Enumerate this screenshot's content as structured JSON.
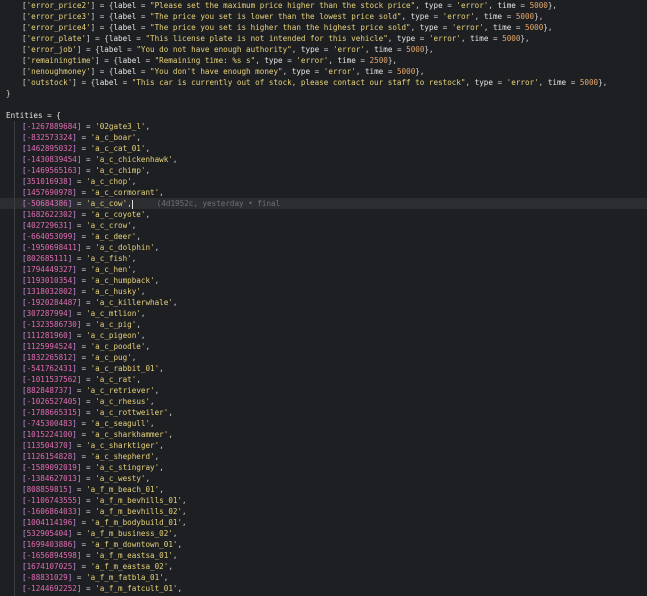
{
  "editor": {
    "error_lines": [
      {
        "key": "'error_price2'",
        "label": "\"Please set the maximum price higher than the stock price\"",
        "type": "'error'",
        "time": "5000"
      },
      {
        "key": "'error_price3'",
        "label": "\"The price you set is lower than the lowest price sold\"",
        "type": "'error'",
        "time": "5000"
      },
      {
        "key": "'error_price4'",
        "label": "\"The price you set is higher than the highest price sold\"",
        "type": "'error'",
        "time": "5000"
      },
      {
        "key": "'error_plate'",
        "label": "\"This license plate is not intended for this vehicle\"",
        "type": "'error'",
        "time": "5000"
      },
      {
        "key": "'error_job'",
        "label": "\"You do not have enough authority\"",
        "type": "'error'",
        "time": "5000"
      },
      {
        "key": "'remainingtime'",
        "label": "\"Remaining time: %s s\"",
        "type": "'error'",
        "time": "2500"
      },
      {
        "key": "'nenoughmoney'",
        "label": "\"You don't have enough money\"",
        "type": "'error'",
        "time": "5000"
      },
      {
        "key": "'outstock'",
        "label": "\"This car is currently out of stock, please contact our staff to restock\"",
        "type": "'error'",
        "time": "5000"
      }
    ],
    "closing_brace": "}",
    "entities_header": "Entities = {",
    "blame_text": "(4d1952c, yesterday • final",
    "entities": [
      {
        "id": "-1267889684",
        "name": "'02gate3_l'"
      },
      {
        "id": "-832573324",
        "name": "'a_c_boar'"
      },
      {
        "id": "1462895032",
        "name": "'a_c_cat_01'"
      },
      {
        "id": "-1430839454",
        "name": "'a_c_chickenhawk'"
      },
      {
        "id": "-1469565163",
        "name": "'a_c_chimp'"
      },
      {
        "id": "351016938",
        "name": "'a_c_chop'"
      },
      {
        "id": "1457690978",
        "name": "'a_c_cormorant'"
      },
      {
        "id": "-50684386",
        "name": "'a_c_cow'"
      },
      {
        "id": "1682622302",
        "name": "'a_c_coyote'"
      },
      {
        "id": "402729631",
        "name": "'a_c_crow'"
      },
      {
        "id": "-664053099",
        "name": "'a_c_deer'"
      },
      {
        "id": "-1950698411",
        "name": "'a_c_dolphin'"
      },
      {
        "id": "802685111",
        "name": "'a_c_fish'"
      },
      {
        "id": "1794449327",
        "name": "'a_c_hen'"
      },
      {
        "id": "1193010354",
        "name": "'a_c_humpback'"
      },
      {
        "id": "1318032802",
        "name": "'a_c_husky'"
      },
      {
        "id": "-1920284487",
        "name": "'a_c_killerwhale'"
      },
      {
        "id": "307287994",
        "name": "'a_c_mtlion'"
      },
      {
        "id": "-1323586730",
        "name": "'a_c_pig'"
      },
      {
        "id": "111281960",
        "name": "'a_c_pigeon'"
      },
      {
        "id": "1125994524",
        "name": "'a_c_poodle'"
      },
      {
        "id": "1832265812",
        "name": "'a_c_pug'"
      },
      {
        "id": "-541762431",
        "name": "'a_c_rabbit_01'"
      },
      {
        "id": "-1011537562",
        "name": "'a_c_rat'"
      },
      {
        "id": "882848737",
        "name": "'a_c_retriever'"
      },
      {
        "id": "-1026527405",
        "name": "'a_c_rhesus'"
      },
      {
        "id": "-1788665315",
        "name": "'a_c_rottweiler'"
      },
      {
        "id": "-745300483",
        "name": "'a_c_seagull'"
      },
      {
        "id": "1015224100",
        "name": "'a_c_sharkhammer'"
      },
      {
        "id": "113504370",
        "name": "'a_c_sharktiger'"
      },
      {
        "id": "1126154828",
        "name": "'a_c_shepherd'"
      },
      {
        "id": "-1589092019",
        "name": "'a_c_stingray'"
      },
      {
        "id": "-1384627013",
        "name": "'a_c_westy'"
      },
      {
        "id": "808859815",
        "name": "'a_f_m_beach_01'"
      },
      {
        "id": "-1106743555",
        "name": "'a_f_m_bevhills_01'"
      },
      {
        "id": "-1606864033",
        "name": "'a_f_m_bevhills_02'"
      },
      {
        "id": "1004114196",
        "name": "'a_f_m_bodybuild_01'"
      },
      {
        "id": "532905404",
        "name": "'a_f_m_business_02'"
      },
      {
        "id": "1699403886",
        "name": "'a_f_m_downtown_01'"
      },
      {
        "id": "-1656894598",
        "name": "'a_f_m_eastsa_01'"
      },
      {
        "id": "1674107025",
        "name": "'a_f_m_eastsa_02'"
      },
      {
        "id": "-88831029",
        "name": "'a_f_m_fatbla_01'"
      },
      {
        "id": "-1244692252",
        "name": "'a_f_m_fatcult_01'"
      }
    ]
  }
}
